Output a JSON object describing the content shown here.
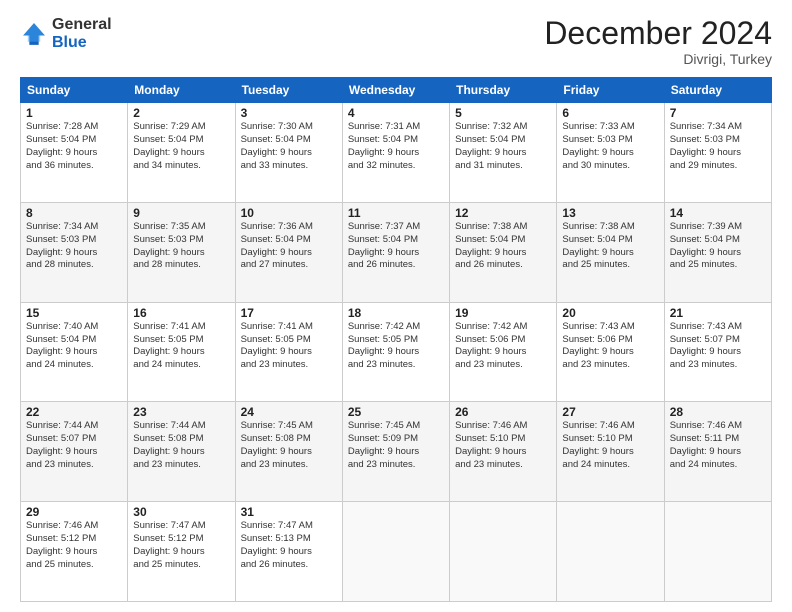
{
  "logo": {
    "general": "General",
    "blue": "Blue"
  },
  "header": {
    "month": "December 2024",
    "location": "Divrigi, Turkey"
  },
  "weekdays": [
    "Sunday",
    "Monday",
    "Tuesday",
    "Wednesday",
    "Thursday",
    "Friday",
    "Saturday"
  ],
  "weeks": [
    [
      {
        "day": "1",
        "info": "Sunrise: 7:28 AM\nSunset: 5:04 PM\nDaylight: 9 hours\nand 36 minutes."
      },
      {
        "day": "2",
        "info": "Sunrise: 7:29 AM\nSunset: 5:04 PM\nDaylight: 9 hours\nand 34 minutes."
      },
      {
        "day": "3",
        "info": "Sunrise: 7:30 AM\nSunset: 5:04 PM\nDaylight: 9 hours\nand 33 minutes."
      },
      {
        "day": "4",
        "info": "Sunrise: 7:31 AM\nSunset: 5:04 PM\nDaylight: 9 hours\nand 32 minutes."
      },
      {
        "day": "5",
        "info": "Sunrise: 7:32 AM\nSunset: 5:04 PM\nDaylight: 9 hours\nand 31 minutes."
      },
      {
        "day": "6",
        "info": "Sunrise: 7:33 AM\nSunset: 5:03 PM\nDaylight: 9 hours\nand 30 minutes."
      },
      {
        "day": "7",
        "info": "Sunrise: 7:34 AM\nSunset: 5:03 PM\nDaylight: 9 hours\nand 29 minutes."
      }
    ],
    [
      {
        "day": "8",
        "info": "Sunrise: 7:34 AM\nSunset: 5:03 PM\nDaylight: 9 hours\nand 28 minutes."
      },
      {
        "day": "9",
        "info": "Sunrise: 7:35 AM\nSunset: 5:03 PM\nDaylight: 9 hours\nand 28 minutes."
      },
      {
        "day": "10",
        "info": "Sunrise: 7:36 AM\nSunset: 5:04 PM\nDaylight: 9 hours\nand 27 minutes."
      },
      {
        "day": "11",
        "info": "Sunrise: 7:37 AM\nSunset: 5:04 PM\nDaylight: 9 hours\nand 26 minutes."
      },
      {
        "day": "12",
        "info": "Sunrise: 7:38 AM\nSunset: 5:04 PM\nDaylight: 9 hours\nand 26 minutes."
      },
      {
        "day": "13",
        "info": "Sunrise: 7:38 AM\nSunset: 5:04 PM\nDaylight: 9 hours\nand 25 minutes."
      },
      {
        "day": "14",
        "info": "Sunrise: 7:39 AM\nSunset: 5:04 PM\nDaylight: 9 hours\nand 25 minutes."
      }
    ],
    [
      {
        "day": "15",
        "info": "Sunrise: 7:40 AM\nSunset: 5:04 PM\nDaylight: 9 hours\nand 24 minutes."
      },
      {
        "day": "16",
        "info": "Sunrise: 7:41 AM\nSunset: 5:05 PM\nDaylight: 9 hours\nand 24 minutes."
      },
      {
        "day": "17",
        "info": "Sunrise: 7:41 AM\nSunset: 5:05 PM\nDaylight: 9 hours\nand 23 minutes."
      },
      {
        "day": "18",
        "info": "Sunrise: 7:42 AM\nSunset: 5:05 PM\nDaylight: 9 hours\nand 23 minutes."
      },
      {
        "day": "19",
        "info": "Sunrise: 7:42 AM\nSunset: 5:06 PM\nDaylight: 9 hours\nand 23 minutes."
      },
      {
        "day": "20",
        "info": "Sunrise: 7:43 AM\nSunset: 5:06 PM\nDaylight: 9 hours\nand 23 minutes."
      },
      {
        "day": "21",
        "info": "Sunrise: 7:43 AM\nSunset: 5:07 PM\nDaylight: 9 hours\nand 23 minutes."
      }
    ],
    [
      {
        "day": "22",
        "info": "Sunrise: 7:44 AM\nSunset: 5:07 PM\nDaylight: 9 hours\nand 23 minutes."
      },
      {
        "day": "23",
        "info": "Sunrise: 7:44 AM\nSunset: 5:08 PM\nDaylight: 9 hours\nand 23 minutes."
      },
      {
        "day": "24",
        "info": "Sunrise: 7:45 AM\nSunset: 5:08 PM\nDaylight: 9 hours\nand 23 minutes."
      },
      {
        "day": "25",
        "info": "Sunrise: 7:45 AM\nSunset: 5:09 PM\nDaylight: 9 hours\nand 23 minutes."
      },
      {
        "day": "26",
        "info": "Sunrise: 7:46 AM\nSunset: 5:10 PM\nDaylight: 9 hours\nand 23 minutes."
      },
      {
        "day": "27",
        "info": "Sunrise: 7:46 AM\nSunset: 5:10 PM\nDaylight: 9 hours\nand 24 minutes."
      },
      {
        "day": "28",
        "info": "Sunrise: 7:46 AM\nSunset: 5:11 PM\nDaylight: 9 hours\nand 24 minutes."
      }
    ],
    [
      {
        "day": "29",
        "info": "Sunrise: 7:46 AM\nSunset: 5:12 PM\nDaylight: 9 hours\nand 25 minutes."
      },
      {
        "day": "30",
        "info": "Sunrise: 7:47 AM\nSunset: 5:12 PM\nDaylight: 9 hours\nand 25 minutes."
      },
      {
        "day": "31",
        "info": "Sunrise: 7:47 AM\nSunset: 5:13 PM\nDaylight: 9 hours\nand 26 minutes."
      },
      {
        "day": "",
        "info": ""
      },
      {
        "day": "",
        "info": ""
      },
      {
        "day": "",
        "info": ""
      },
      {
        "day": "",
        "info": ""
      }
    ]
  ]
}
